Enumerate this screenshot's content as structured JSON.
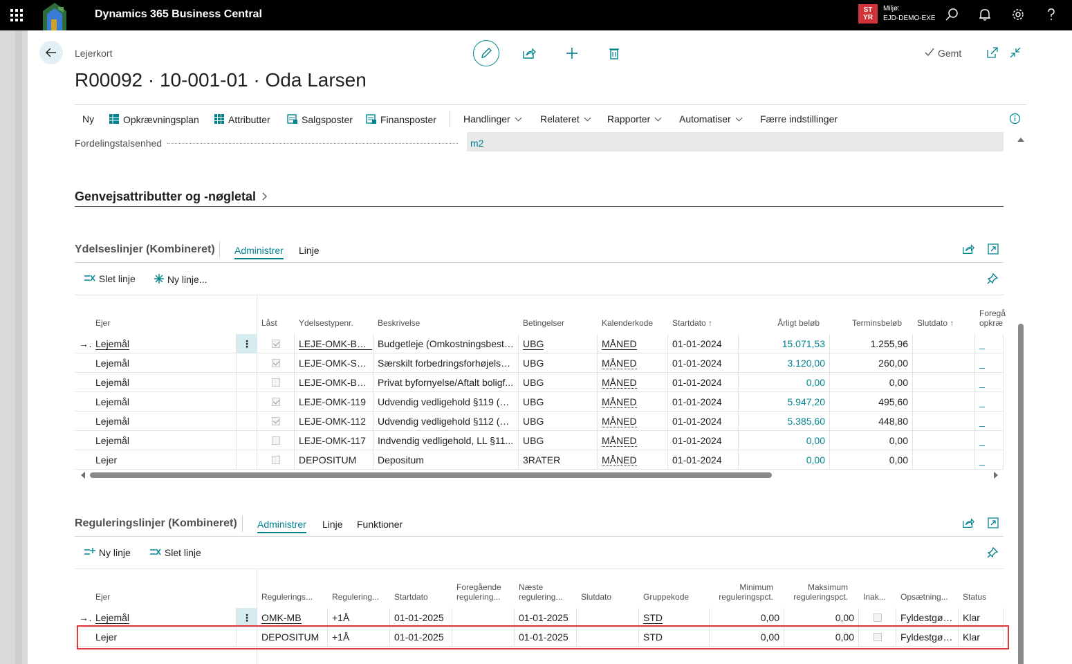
{
  "app": {
    "title": "Dynamics 365 Business Central",
    "env_badge_line1": "ST",
    "env_badge_line2": "YR",
    "env_label": "Miljø:",
    "env_name": "EJD-DEMO-EXE"
  },
  "page": {
    "breadcrumb": "Lejerkort",
    "title": "R00092 · 10-001-01 · Oda Larsen",
    "saved_label": "Gemt"
  },
  "actionbar": {
    "items": [
      "Ny",
      "Opkrævningsplan",
      "Attributter",
      "Salgsposter",
      "Finansposter",
      "Handlinger",
      "Relateret",
      "Rapporter",
      "Automatiser",
      "Færre indstillinger"
    ]
  },
  "field": {
    "label": "Fordelingstalsenhed",
    "value": "m2"
  },
  "factbox_section": {
    "title": "Genvejsattributter og -nøgletal"
  },
  "ydelse": {
    "title": "Ydelseslinjer (Kombineret)",
    "tabs": [
      "Administrer",
      "Linje"
    ],
    "actions": [
      "Slet linje",
      "Ny linje..."
    ],
    "columns": [
      "Ejer",
      "Låst",
      "Ydelsestypenr.",
      "Beskrivelse",
      "Betingelser",
      "Kalenderkode",
      "Startdato",
      "Årligt beløb",
      "Terminsbeløb",
      "Slutdato",
      "Foregå",
      "opkræ"
    ],
    "rows": [
      {
        "ejer": "Lejemål",
        "laast": true,
        "type": "LEJE-OMK-BU...",
        "beskrivelse": "Budgetleje (Omkostningsbeste...",
        "betingelser": "UBG",
        "kalender": "MÅNED",
        "start": "01-01-2024",
        "aarligt": "15.071,53",
        "termin": "1.255,96",
        "slut": "",
        "foreg": "_"
      },
      {
        "ejer": "Lejemål",
        "laast": true,
        "type": "LEJE-OMK-SÆ...",
        "beskrivelse": "Særskilt forbedringsforhøjelse ...",
        "betingelser": "UBG",
        "kalender": "MÅNED",
        "start": "01-01-2024",
        "aarligt": "3.120,00",
        "termin": "260,00",
        "slut": "",
        "foreg": "_"
      },
      {
        "ejer": "Lejemål",
        "laast": false,
        "type": "LEJE-OMK-BY-...",
        "beskrivelse": "Privat byfornyelse/Aftalt boligf...",
        "betingelser": "UBG",
        "kalender": "MÅNED",
        "start": "01-01-2024",
        "aarligt": "0,00",
        "termin": "0,00",
        "slut": "",
        "foreg": "_"
      },
      {
        "ejer": "Lejemål",
        "laast": true,
        "type": "LEJE-OMK-119",
        "beskrivelse": "Udvendig vedligehold §119 (O...",
        "betingelser": "UBG",
        "kalender": "MÅNED",
        "start": "01-01-2024",
        "aarligt": "5.947,20",
        "termin": "495,60",
        "slut": "",
        "foreg": "_"
      },
      {
        "ejer": "Lejemål",
        "laast": true,
        "type": "LEJE-OMK-112",
        "beskrivelse": "Udvendig vedligehold §112 (O...",
        "betingelser": "UBG",
        "kalender": "MÅNED",
        "start": "01-01-2024",
        "aarligt": "5.385,60",
        "termin": "448,80",
        "slut": "",
        "foreg": "_"
      },
      {
        "ejer": "Lejemål",
        "laast": false,
        "type": "LEJE-OMK-117",
        "beskrivelse": "Indvendig vedligehold, LL §11...",
        "betingelser": "UBG",
        "kalender": "MÅNED",
        "start": "01-01-2024",
        "aarligt": "0,00",
        "termin": "0,00",
        "slut": "",
        "foreg": "_"
      },
      {
        "ejer": "Lejer",
        "laast": false,
        "type": "DEPOSITUM",
        "beskrivelse": "Depositum",
        "betingelser": "3RATER",
        "kalender": "MÅNED",
        "start": "01-01-2024",
        "aarligt": "0,00",
        "termin": "0,00",
        "slut": "",
        "foreg": "_"
      }
    ]
  },
  "regulering": {
    "title": "Reguleringslinjer (Kombineret)",
    "tabs": [
      "Administrer",
      "Linje",
      "Funktioner"
    ],
    "actions": [
      "Ny linje",
      "Slet linje"
    ],
    "columns": [
      "Ejer",
      "Regulerings...",
      "Regulering...",
      "Startdato",
      "Foregående",
      "regulering...",
      "Næste",
      "regulering...",
      "Slutdato",
      "Gruppekode",
      "Minimum",
      "reguleringspct.",
      "Maksimum",
      "reguleringspct.",
      "Inak...",
      "Opsætning...",
      "Status"
    ],
    "rows": [
      {
        "ejer": "Lejemål",
        "regtype": "OMK-MB",
        "reg": "+1Å",
        "start": "01-01-2025",
        "foreg": "",
        "naeste": "01-01-2025",
        "slut": "",
        "gruppe": "STD",
        "min": "0,00",
        "maks": "0,00",
        "inak": false,
        "ops": "Fyldestgør...",
        "status": "Klar"
      },
      {
        "ejer": "Lejer",
        "regtype": "DEPOSITUM",
        "reg": "+1Å",
        "start": "01-01-2025",
        "foreg": "",
        "naeste": "01-01-2025",
        "slut": "",
        "gruppe": "STD",
        "min": "0,00",
        "maks": "0,00",
        "inak": false,
        "ops": "Fyldestgør...",
        "status": "Klar"
      }
    ]
  },
  "colors": {
    "accent": "#00838f",
    "topbar": "#000000",
    "highlight": "#e0373f",
    "env_badge": "#d13438"
  }
}
